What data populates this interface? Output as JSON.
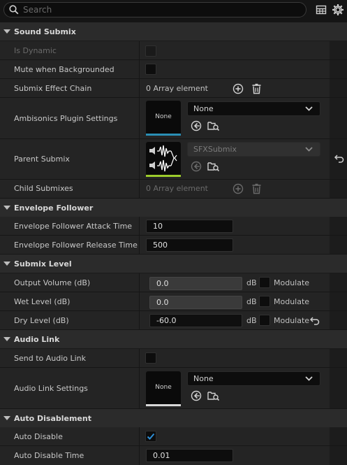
{
  "search": {
    "placeholder": "Search"
  },
  "sections": {
    "sound_submix": "Sound Submix",
    "envelope_follower": "Envelope Follower",
    "submix_level": "Submix Level",
    "audio_link": "Audio Link",
    "auto_disablement": "Auto Disablement"
  },
  "props": {
    "is_dynamic": {
      "label": "Is Dynamic",
      "checked": false
    },
    "mute_when_backgrounded": {
      "label": "Mute when Backgrounded",
      "checked": false
    },
    "submix_effect_chain": {
      "label": "Submix Effect Chain",
      "value": "0 Array element"
    },
    "ambisonics_plugin_settings": {
      "label": "Ambisonics Plugin Settings",
      "thumb": "None",
      "combo": "None"
    },
    "parent_submix": {
      "label": "Parent Submix",
      "combo": "SFXSubmix"
    },
    "child_submixes": {
      "label": "Child Submixes",
      "value": "0 Array element"
    },
    "attack_time": {
      "label": "Envelope Follower Attack Time",
      "value": "10"
    },
    "release_time": {
      "label": "Envelope Follower Release Time",
      "value": "500"
    },
    "output_volume": {
      "label": "Output Volume (dB)",
      "value": "0.0",
      "unit": "dB",
      "modulate": "Modulate"
    },
    "wet_level": {
      "label": "Wet Level (dB)",
      "value": "0.0",
      "unit": "dB",
      "modulate": "Modulate"
    },
    "dry_level": {
      "label": "Dry Level (dB)",
      "value": "-60.0",
      "unit": "dB",
      "modulate": "Modulate"
    },
    "send_to_audio_link": {
      "label": "Send to Audio Link",
      "checked": false
    },
    "audio_link_settings": {
      "label": "Audio Link Settings",
      "thumb": "None",
      "combo": "None"
    },
    "auto_disable": {
      "label": "Auto Disable",
      "checked": true
    },
    "auto_disable_time": {
      "label": "Auto Disable Time",
      "value": "0.01"
    }
  },
  "colors": {
    "accent": "#2e8fd6",
    "ambisonics_bar": "#2a8fb5",
    "parent_bar": "#9ccc2c",
    "check": "#2e8fd6"
  },
  "icons": [
    "search-icon",
    "table-view-icon",
    "gear-icon",
    "add-icon",
    "trash-icon",
    "browse-icon",
    "use-selected-icon",
    "reset-arrow-icon",
    "chevron-down-icon"
  ]
}
